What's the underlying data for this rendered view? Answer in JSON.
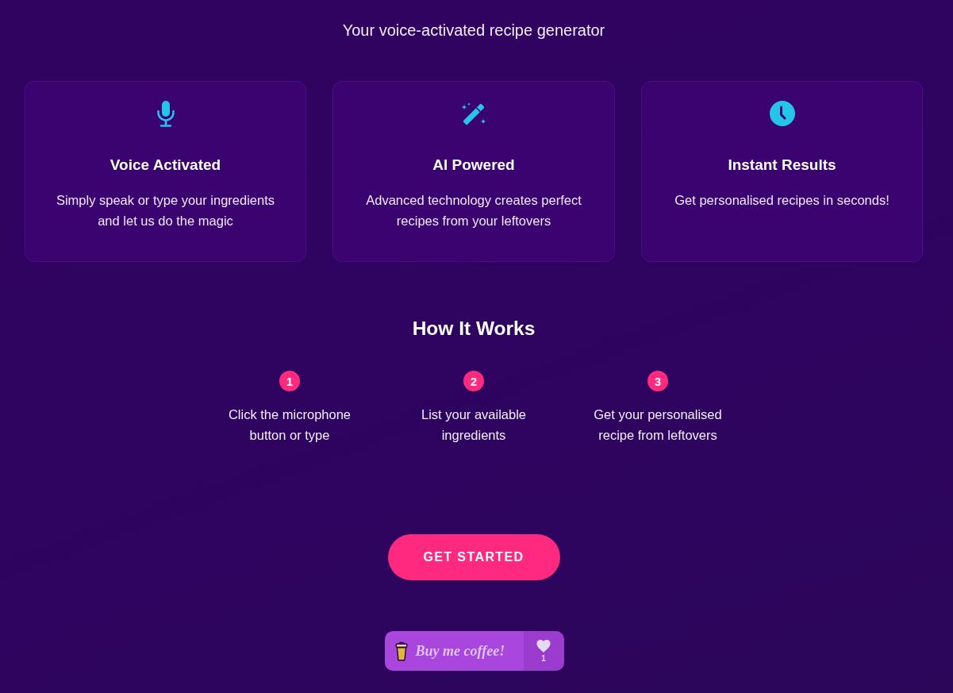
{
  "subtitle": "Your voice-activated recipe generator",
  "features": [
    {
      "kind": "microphone",
      "title": "Voice Activated",
      "description": "Simply speak or type your ingredients and let us do the magic"
    },
    {
      "kind": "wand",
      "title": "AI Powered",
      "description": "Advanced technology creates perfect recipes from your leftovers"
    },
    {
      "kind": "clock",
      "title": "Instant Results",
      "description": "Get personalised recipes in seconds!"
    }
  ],
  "how_it_works": {
    "title": "How It Works",
    "steps": [
      {
        "number": "1",
        "text": "Click the microphone button or type"
      },
      {
        "number": "2",
        "text": "List your available ingredients"
      },
      {
        "number": "3",
        "text": "Get your personalised recipe from leftovers"
      }
    ]
  },
  "get_started_button": {
    "label": "GET STARTED"
  },
  "coffee_widget": {
    "label": "Buy me coffee!",
    "like_count": "1"
  }
}
